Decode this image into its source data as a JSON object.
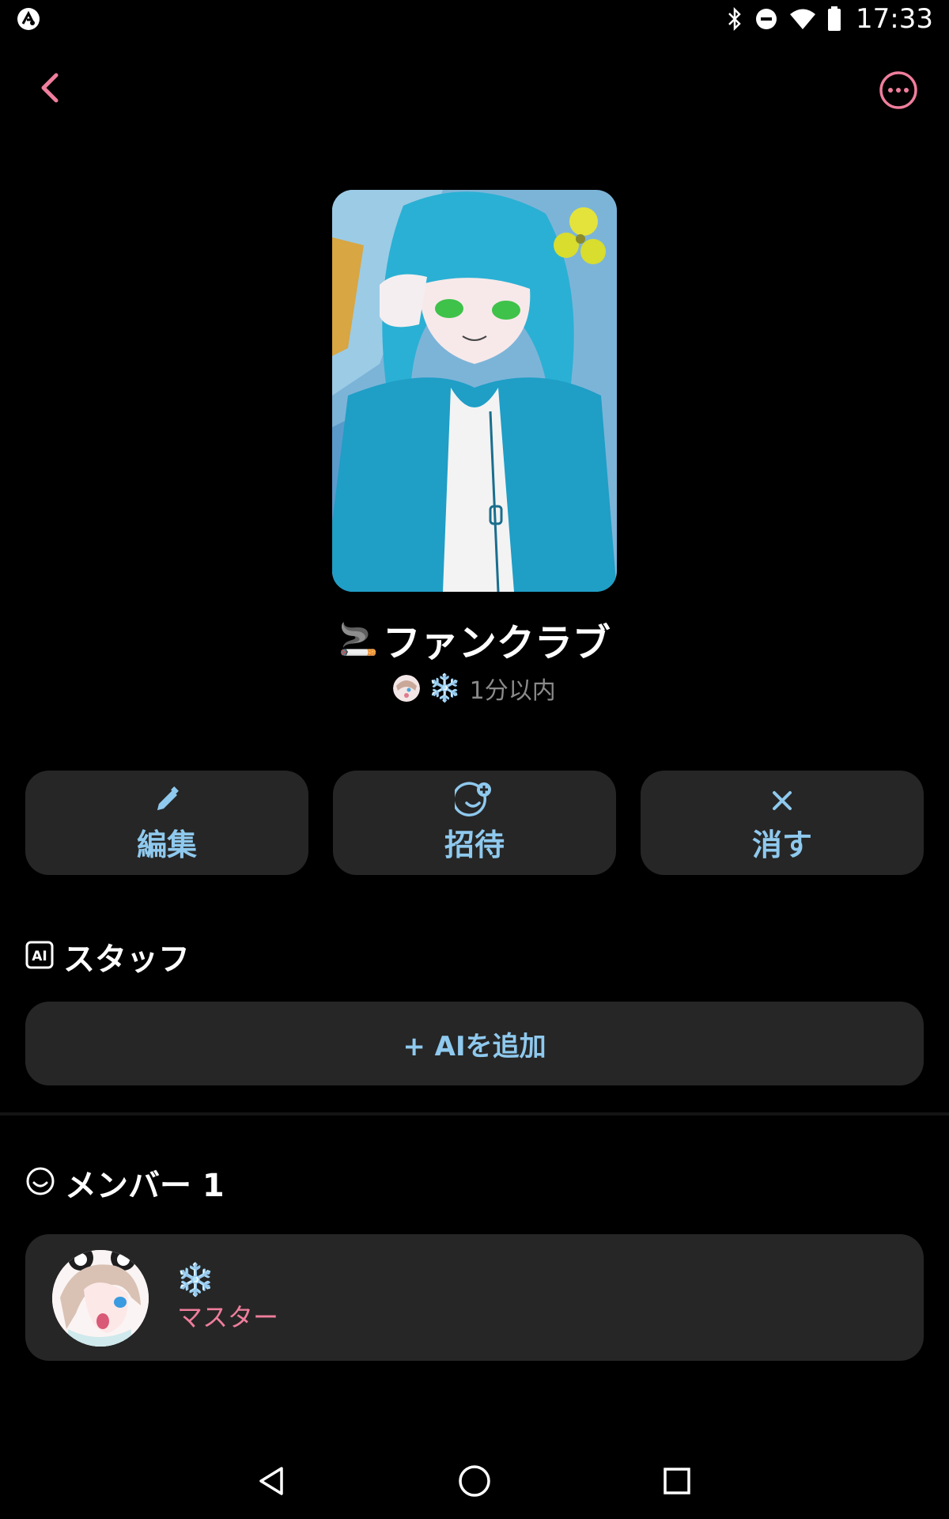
{
  "status_bar": {
    "time": "17:33",
    "icons": [
      "app-notification-icon",
      "bluetooth-icon",
      "do-not-disturb-icon",
      "wifi-icon",
      "battery-icon"
    ]
  },
  "header": {
    "back_icon": "chevron-left-icon",
    "more_icon": "more-horizontal-icon",
    "accent_color": "#ef7e9c"
  },
  "club": {
    "title_emoji": "🚬",
    "title": "ファンクラブ",
    "owner_emoji": "❄️",
    "last_active": "1分以内"
  },
  "actions": [
    {
      "label": "編集",
      "icon": "pencil-icon"
    },
    {
      "label": "招待",
      "icon": "add-person-icon"
    },
    {
      "label": "消す",
      "icon": "close-icon"
    }
  ],
  "staff_section": {
    "title": "スタッフ",
    "icon": "ai-badge-icon",
    "add_button_label": "+ AIを追加"
  },
  "members_section": {
    "title": "メンバー 1",
    "icon": "smile-icon",
    "members": [
      {
        "emoji": "❄️",
        "role": "マスター"
      }
    ]
  },
  "nav_bar": {
    "icons": [
      "back-triangle-icon",
      "home-circle-icon",
      "recents-square-icon"
    ]
  },
  "colors": {
    "background": "#000000",
    "card": "#262626",
    "button_text": "#8fc9ee",
    "role_text": "#ef7e9c",
    "muted_text": "#8a8a8a"
  }
}
